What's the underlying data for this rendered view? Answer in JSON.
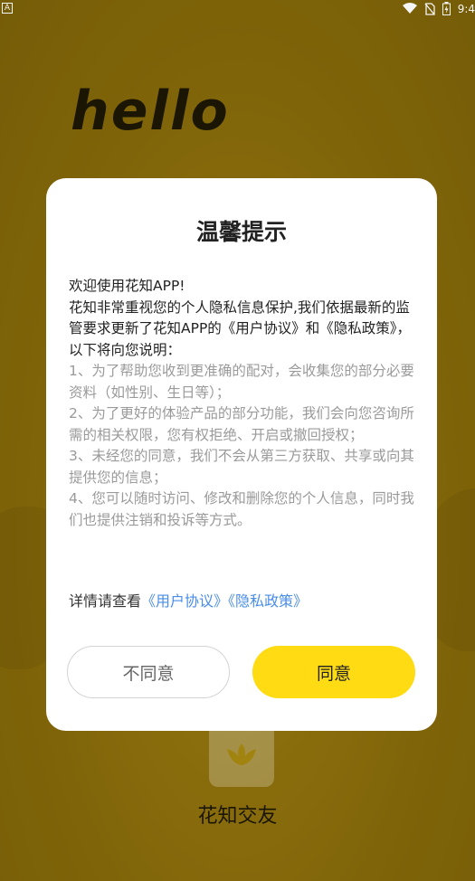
{
  "status_bar": {
    "left_icon_letter": "A",
    "clock": "9:4",
    "icons": [
      "wifi-icon",
      "no-sim-icon",
      "battery-icon"
    ]
  },
  "background": {
    "hello_text": "hello",
    "app_name": "花知交友"
  },
  "dialog": {
    "title": "温馨提示",
    "intro": [
      "欢迎使用花知APP!",
      "花知非常重视您的个人隐私信息保护,我们依据最新的监管要求更新了花知APP的《用户协议》和《隐私政策》，以下将向您说明："
    ],
    "items": [
      "1、为了帮助您收到更准确的配对，会收集您的部分必要资料（如性别、生日等）；",
      "2、为了更好的体验产品的部分功能，我们会向您咨询所需的相关权限，您有权拒绝、开启或撤回授权；",
      "3、未经您的同意，我们不会从第三方获取、共享或向其提供您的信息；",
      "4、您可以随时访问、修改和删除您的个人信息，同时我们也提供注销和投诉等方式。"
    ],
    "details_prefix": "详情请查看",
    "link_user_agreement": "《用户协议》",
    "link_privacy_policy": "《隐私政策》",
    "disagree_label": "不同意",
    "agree_label": "同意"
  },
  "colors": {
    "background": "#86690a",
    "agree_button": "#fedb12",
    "link": "#4a8de8"
  }
}
